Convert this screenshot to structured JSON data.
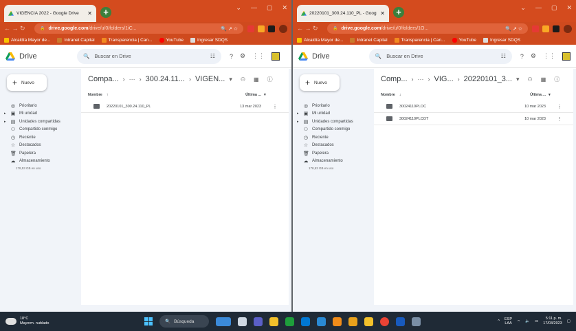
{
  "left_window": {
    "tab_title": "VIGENCIA 2022 - Google Drive",
    "url_domain": "drive.google.com",
    "url_path": "/drive/u/0/folders/1iC...",
    "breadcrumb": [
      "Compa...",
      "···",
      "300.24.11...",
      "VIGEN..."
    ],
    "sort_col": "Nombre",
    "sort_arrow": "↑",
    "modified_col": "Última ...",
    "rows": [
      {
        "name": "20220101_300.24.110_PL",
        "date": "13 mar 2023"
      }
    ]
  },
  "right_window": {
    "tab_title": "20220101_300.24.110_PL - Goog",
    "url_domain": "drive.google.com",
    "url_path": "/drive/u/0/folders/1O...",
    "breadcrumb": [
      "Comp...",
      "···",
      "VIG...",
      "20220101_3..."
    ],
    "sort_col": "Nombre",
    "sort_arrow": "↓",
    "modified_col": "Última ...",
    "rows": [
      {
        "name": "30024110PLOC",
        "date": "10 mar 2023"
      },
      {
        "name": "30024110PLCOT",
        "date": "10 mar 2023"
      }
    ]
  },
  "bookmarks": [
    "Alcaldía Mayor de...",
    "Intranet Capital",
    "Transparencia | Can...",
    "YouTube",
    "Ingresar SDQS"
  ],
  "drive": {
    "app_name": "Drive",
    "search_placeholder": "Buscar en Drive",
    "new_button": "Nuevo",
    "nav": [
      "Prioritario",
      "Mi unidad",
      "Unidades compartidas",
      "Compartido conmigo",
      "Reciente",
      "Destacados",
      "Papelera",
      "Almacenamiento"
    ],
    "storage_used": "178,53 GB en uso"
  },
  "taskbar": {
    "temp": "18°C",
    "weather": "Mayorm. nublado",
    "search": "Búsqueda",
    "lang1": "ESP",
    "lang2": "LAA",
    "time": "5:11 p. m.",
    "date": "17/03/2023"
  },
  "colors": {
    "chrome_theme": "#d44b1e",
    "drive_bg": "#f1f4f9",
    "taskbar": "#1f2a36"
  }
}
